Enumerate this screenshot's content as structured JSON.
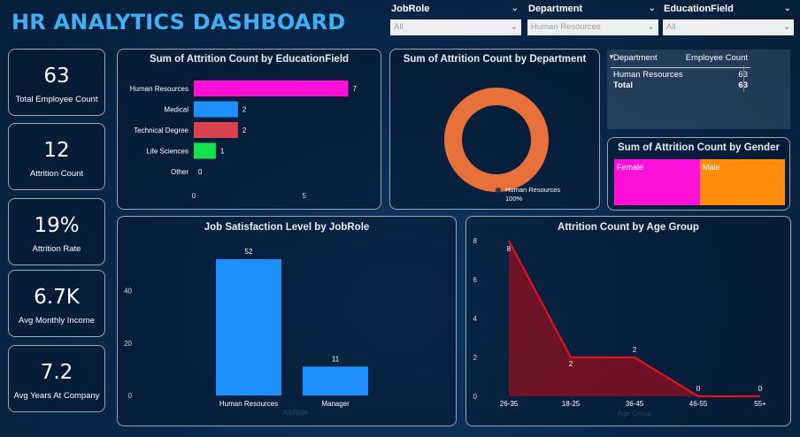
{
  "title": "HR ANALYTICS DASHBOARD",
  "slicers": [
    {
      "label": "JobRole",
      "value": "All"
    },
    {
      "label": "Department",
      "value": "Human Resources"
    },
    {
      "label": "EducationField",
      "value": "All"
    }
  ],
  "kpis": [
    {
      "value": "63",
      "caption": "Total Employee Count"
    },
    {
      "value": "12",
      "caption": "Attrition Count"
    },
    {
      "value": "19%",
      "caption": "Attrition Rate"
    },
    {
      "value": "6.7K",
      "caption": "Avg Monthly Income"
    },
    {
      "value": "7.2",
      "caption": "Avg Years At Company"
    }
  ],
  "dept_table": {
    "headers": [
      "Department",
      "Employee Count"
    ],
    "rows": [
      {
        "name": "Human Resources",
        "value": "63"
      }
    ],
    "total": {
      "name": "Total",
      "value": "63"
    }
  },
  "gender": {
    "title": "Sum of Attrition Count by Gender",
    "segments": [
      {
        "name": "Female",
        "color": "#ff10d8"
      },
      {
        "name": "Male",
        "color": "#ff8c0a"
      }
    ]
  },
  "chart_data": [
    {
      "type": "bar",
      "orientation": "horizontal",
      "title": "Sum of Attrition Count by EducationField",
      "categories": [
        "Human Resources",
        "Medical",
        "Technical Degree",
        "Life Sciences",
        "Other"
      ],
      "values": [
        7,
        2,
        2,
        1,
        0
      ],
      "colors": [
        "#ff10d8",
        "#1e90ff",
        "#d9424f",
        "#12e34a",
        "#888888"
      ],
      "xticks": [
        "0",
        "5"
      ],
      "xlim": [
        0,
        8
      ]
    },
    {
      "type": "pie",
      "title": "Sum of Attrition Count by Department",
      "slices": [
        {
          "name": "Human Resources",
          "value": 100,
          "label": "100%",
          "color": "#e8703a"
        }
      ]
    },
    {
      "type": "bar",
      "title": "Job Satisfaction Level by JobRole",
      "categories": [
        "Human Resources",
        "Manager"
      ],
      "values": [
        52,
        11
      ],
      "color": "#1e90ff",
      "xlabel": "JobRole",
      "yticks": [
        0,
        20,
        40
      ],
      "ylim": [
        0,
        60
      ]
    },
    {
      "type": "area",
      "title": "Attrition Count by Age Group",
      "categories": [
        "26-35",
        "18-25",
        "36-45",
        "46-55",
        "55+"
      ],
      "values": [
        8,
        2,
        2,
        0,
        0
      ],
      "color": "#e0121c",
      "xlabel": "Age Group",
      "yticks": [
        0,
        2,
        4,
        6,
        8
      ],
      "ylim": [
        0,
        8
      ]
    }
  ]
}
